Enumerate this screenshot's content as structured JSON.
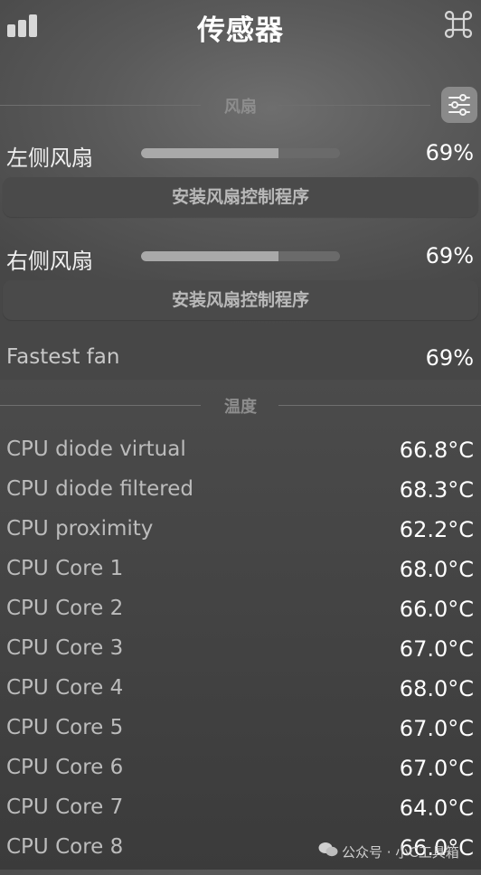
{
  "header": {
    "title": "传感器",
    "left_icon": "signal-bars-icon",
    "right_icon": "command-icon"
  },
  "fans_section": {
    "title": "风扇",
    "settings_icon": "sliders-icon",
    "fans": [
      {
        "label": "左侧风扇",
        "value": "69%",
        "level": 0.69,
        "button_label": "安装风扇控制程序"
      },
      {
        "label": "右侧风扇",
        "value": "69%",
        "level": 0.69,
        "button_label": "安装风扇控制程序"
      }
    ],
    "fastest": {
      "label": "Fastest fan",
      "value": "69%"
    }
  },
  "temperature_section": {
    "title": "温度",
    "rows": [
      {
        "name": "CPU diode virtual",
        "value": "66.8°C"
      },
      {
        "name": "CPU diode filtered",
        "value": "68.3°C"
      },
      {
        "name": "CPU proximity",
        "value": "62.2°C"
      },
      {
        "name": "CPU Core 1",
        "value": "68.0°C"
      },
      {
        "name": "CPU Core 2",
        "value": "66.0°C"
      },
      {
        "name": "CPU Core 3",
        "value": "67.0°C"
      },
      {
        "name": "CPU Core 4",
        "value": "68.0°C"
      },
      {
        "name": "CPU Core 5",
        "value": "67.0°C"
      },
      {
        "name": "CPU Core 6",
        "value": "67.0°C"
      },
      {
        "name": "CPU Core 7",
        "value": "64.0°C"
      },
      {
        "name": "CPU Core 8",
        "value": "66.0°C"
      }
    ]
  },
  "watermark": {
    "text": "公众号 · 小C工具箱",
    "icon": "wechat-icon"
  }
}
